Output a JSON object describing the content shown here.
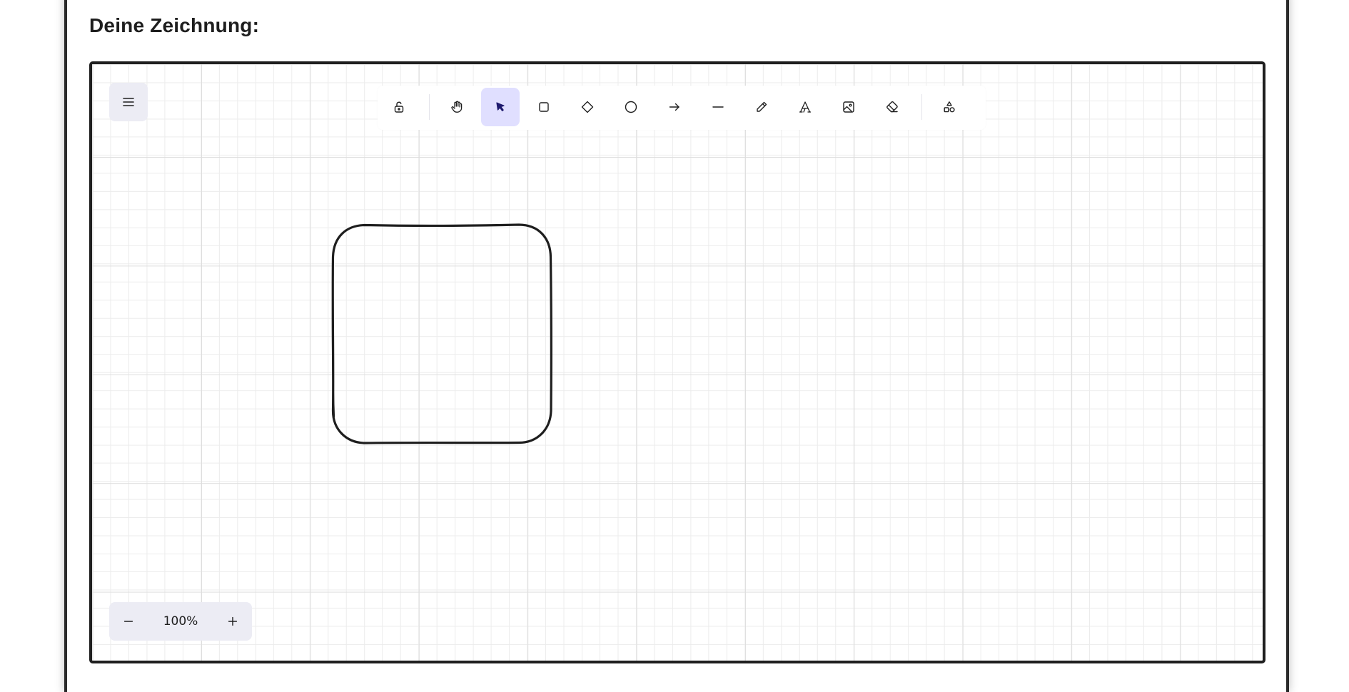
{
  "heading": "Deine Zeichnung:",
  "menu": {
    "icon": "hamburger-menu-icon"
  },
  "toolbar": {
    "tools": [
      {
        "name": "lock",
        "icon": "unlock-icon",
        "active": false
      },
      {
        "name": "hand",
        "icon": "hand-icon",
        "active": false
      },
      {
        "name": "selection",
        "icon": "cursor-arrow-icon",
        "active": true
      },
      {
        "name": "rectangle",
        "icon": "square-icon",
        "active": false
      },
      {
        "name": "diamond",
        "icon": "diamond-icon",
        "active": false
      },
      {
        "name": "ellipse",
        "icon": "circle-icon",
        "active": false
      },
      {
        "name": "arrow",
        "icon": "arrow-right-icon",
        "active": false
      },
      {
        "name": "line",
        "icon": "line-icon",
        "active": false
      },
      {
        "name": "draw",
        "icon": "pencil-icon",
        "active": false
      },
      {
        "name": "text",
        "icon": "text-a-icon",
        "active": false
      },
      {
        "name": "image",
        "icon": "image-icon",
        "active": false
      },
      {
        "name": "eraser",
        "icon": "eraser-icon",
        "active": false
      },
      {
        "name": "more-shapes",
        "icon": "shapes-icon",
        "active": false
      }
    ],
    "active_color": "#e0dfff",
    "active_icon_color": "#1e1a6e"
  },
  "canvas": {
    "shapes": [
      {
        "type": "rounded-rectangle",
        "stroke": "#1e1e1e"
      }
    ]
  },
  "zoom": {
    "level": "100%",
    "decrease_icon": "minus-icon",
    "increase_icon": "plus-icon"
  },
  "colors": {
    "panel_bg": "#ececf4",
    "frame_border": "#1f1f1f",
    "text": "#1e1e1e"
  }
}
